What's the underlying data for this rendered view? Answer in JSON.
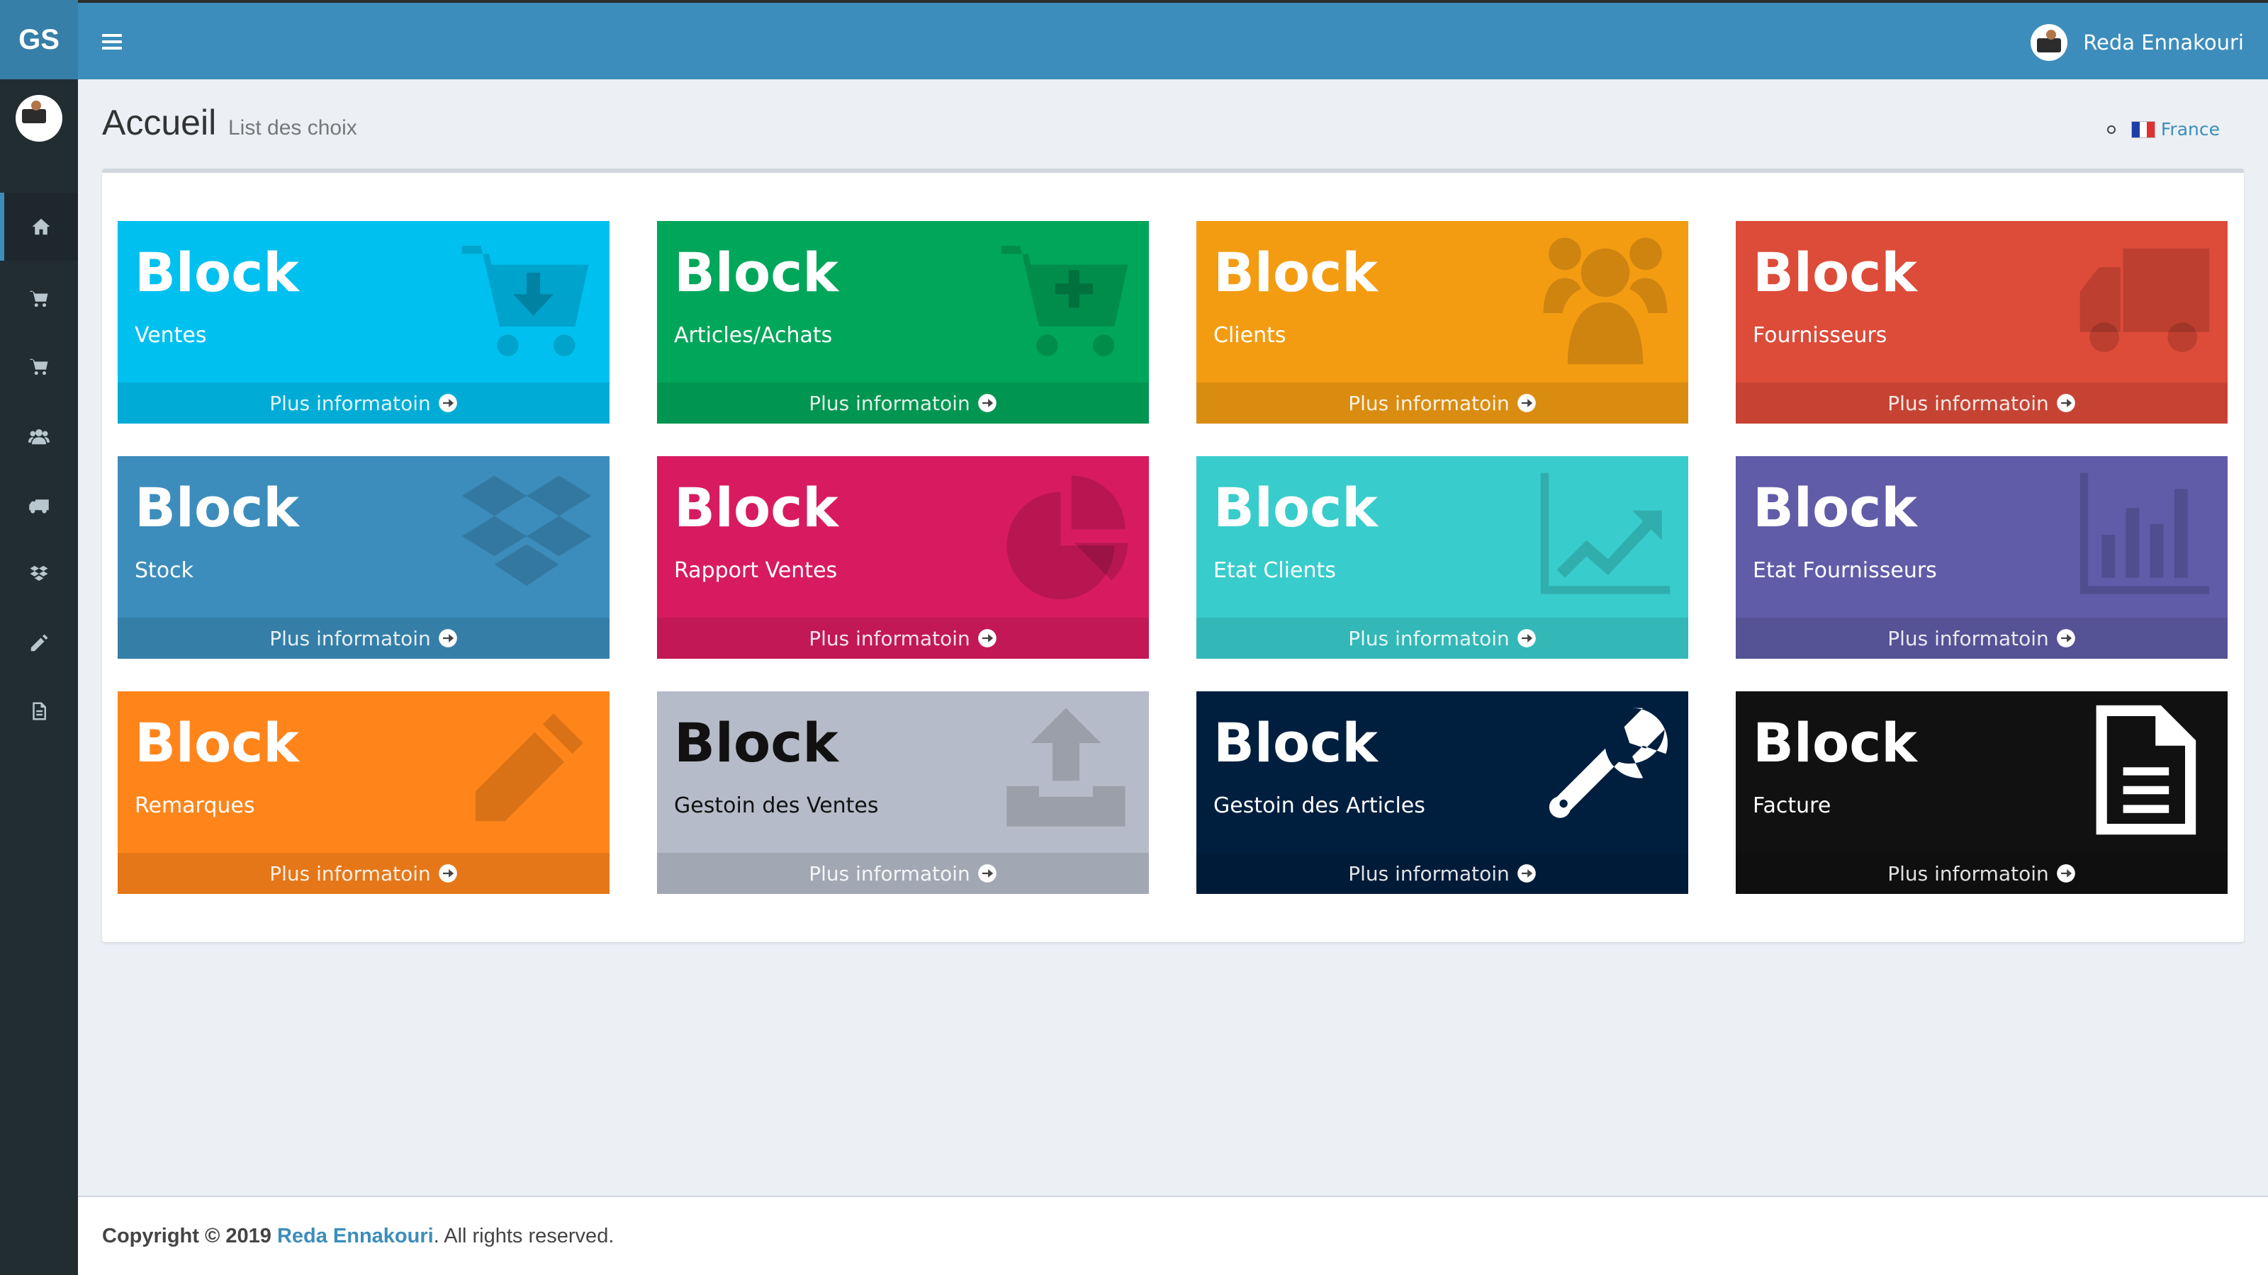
{
  "app": {
    "logo": "GS"
  },
  "user": {
    "name": "Reda Ennakouri"
  },
  "page": {
    "title": "Accueil",
    "subtitle": "List des choix"
  },
  "breadcrumb": {
    "label": "France"
  },
  "sidebar": {
    "items": [
      {
        "icon": "home-icon"
      },
      {
        "icon": "cart-download-icon"
      },
      {
        "icon": "cart-plus-icon"
      },
      {
        "icon": "users-icon"
      },
      {
        "icon": "truck-icon"
      },
      {
        "icon": "dropbox-icon"
      },
      {
        "icon": "pencil-icon"
      },
      {
        "icon": "file-icon"
      }
    ]
  },
  "tiles": [
    {
      "title": "Block",
      "subtitle": "Ventes",
      "footer": "Plus informatoin",
      "color": "#00c0ef",
      "icon": "cart-download-icon"
    },
    {
      "title": "Block",
      "subtitle": "Articles/Achats",
      "footer": "Plus informatoin",
      "color": "#00a65a",
      "icon": "cart-plus-icon"
    },
    {
      "title": "Block",
      "subtitle": "Clients",
      "footer": "Plus informatoin",
      "color": "#f39c12",
      "icon": "users-icon"
    },
    {
      "title": "Block",
      "subtitle": "Fournisseurs",
      "footer": "Plus informatoin",
      "color": "#dd4b39",
      "icon": "truck-icon"
    },
    {
      "title": "Block",
      "subtitle": "Stock",
      "footer": "Plus informatoin",
      "color": "#3c8dbc",
      "icon": "dropbox-icon"
    },
    {
      "title": "Block",
      "subtitle": "Rapport Ventes",
      "footer": "Plus informatoin",
      "color": "#d81b60",
      "icon": "pie-chart-icon"
    },
    {
      "title": "Block",
      "subtitle": "Etat Clients",
      "footer": "Plus informatoin",
      "color": "#39cccc",
      "icon": "line-chart-icon"
    },
    {
      "title": "Block",
      "subtitle": "Etat Fournisseurs",
      "footer": "Plus informatoin",
      "color": "#605ca8",
      "icon": "bar-chart-icon"
    },
    {
      "title": "Block",
      "subtitle": "Remarques",
      "footer": "Plus informatoin",
      "color": "#ff851b",
      "icon": "pencil-icon"
    },
    {
      "title": "Block",
      "subtitle": "Gestoin des Ventes",
      "footer": "Plus informatoin",
      "color": "#b5bbc8",
      "icon": "upload-icon"
    },
    {
      "title": "Block",
      "subtitle": "Gestoin des Articles",
      "footer": "Plus informatoin",
      "color": "#001f3f",
      "icon": "wrench-icon"
    },
    {
      "title": "Block",
      "subtitle": "Facture",
      "footer": "Plus informatoin",
      "color": "#111111",
      "icon": "file-icon"
    }
  ],
  "footer": {
    "copyright": "Copyright © 2019",
    "author": "Reda Ennakouri",
    "rights": ". All rights reserved."
  }
}
